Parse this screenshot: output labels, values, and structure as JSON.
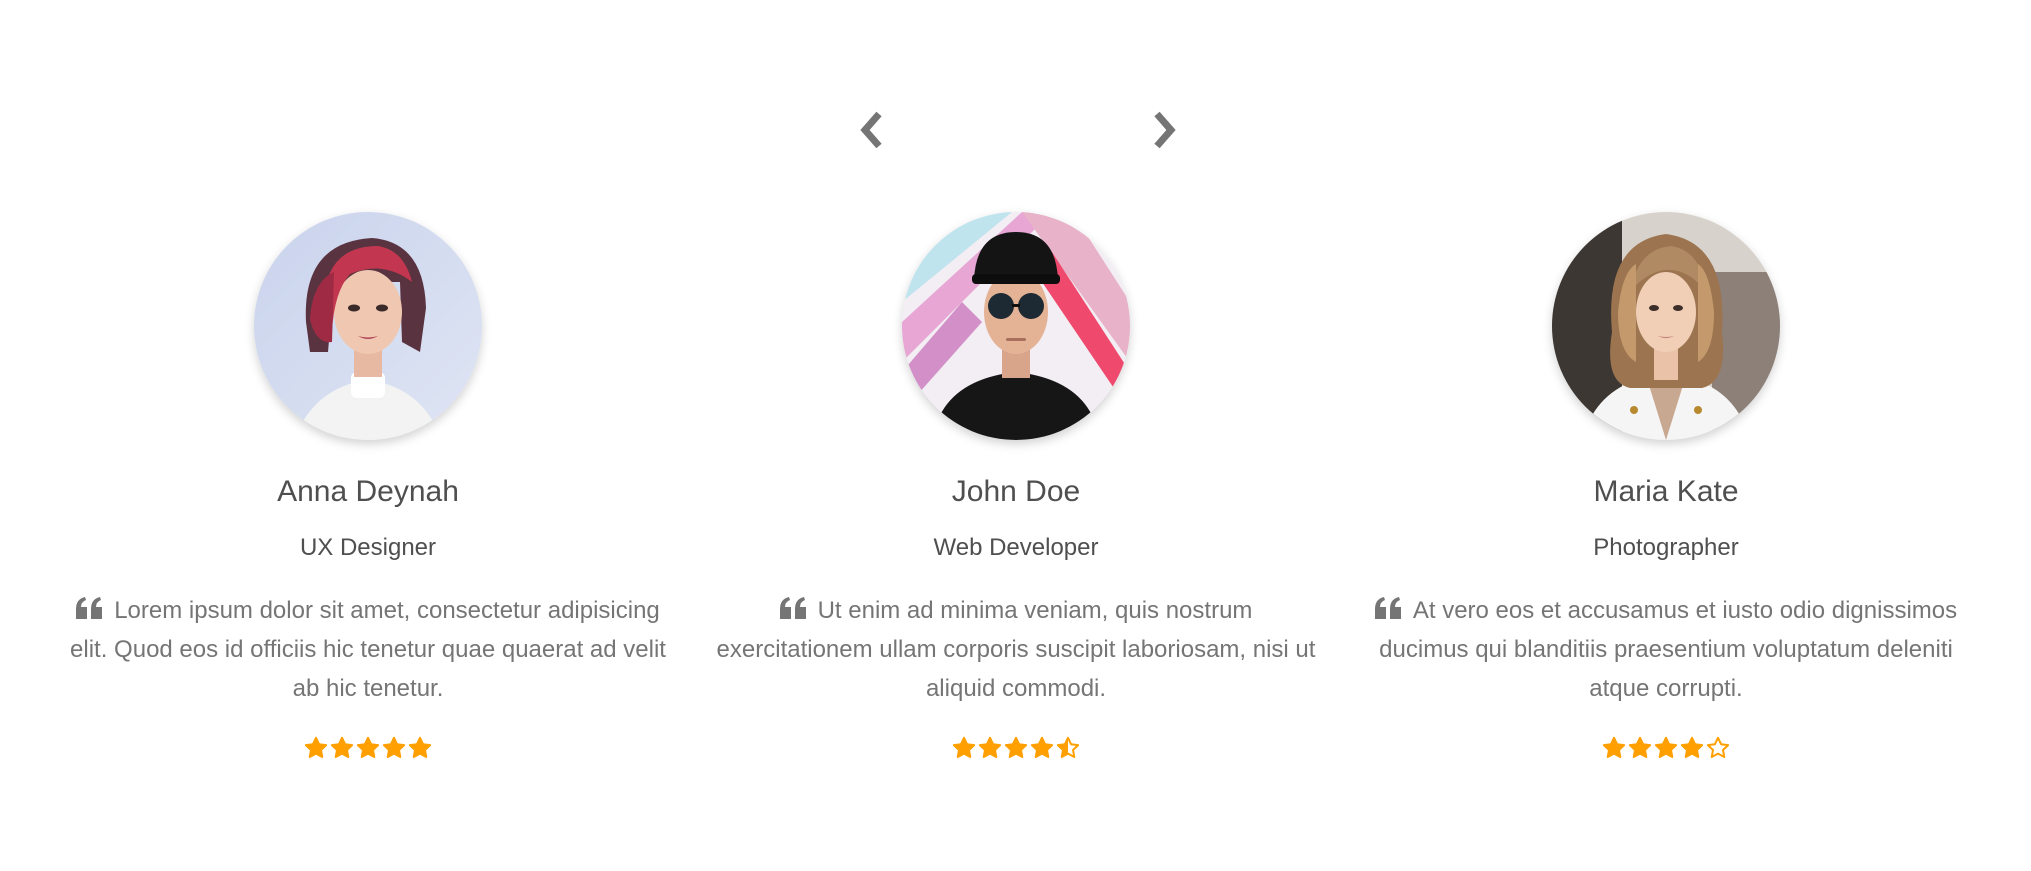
{
  "carousel": {
    "prev_icon": "chevron-left-icon",
    "next_icon": "chevron-right-icon"
  },
  "colors": {
    "text": "#4f4f4f",
    "muted": "#757575",
    "star": "#ffa000",
    "arrow": "#757575"
  },
  "testimonials": [
    {
      "name": "Anna Deynah",
      "role": "UX Designer",
      "quote": "Lorem ipsum dolor sit amet, consectetur adipisicing elit. Quod eos id officiis hic tenetur quae quaerat ad velit ab hic tenetur.",
      "rating": 5,
      "avatar_icon": "avatar-photo"
    },
    {
      "name": "John Doe",
      "role": "Web Developer",
      "quote": "Ut enim ad minima veniam, quis nostrum exercitationem ullam corporis suscipit laboriosam, nisi ut aliquid commodi.",
      "rating": 4.5,
      "avatar_icon": "avatar-photo"
    },
    {
      "name": "Maria Kate",
      "role": "Photographer",
      "quote": "At vero eos et accusamus et iusto odio dignissimos ducimus qui blanditiis praesentium voluptatum deleniti atque corrupti.",
      "rating": 4,
      "avatar_icon": "avatar-photo"
    }
  ]
}
